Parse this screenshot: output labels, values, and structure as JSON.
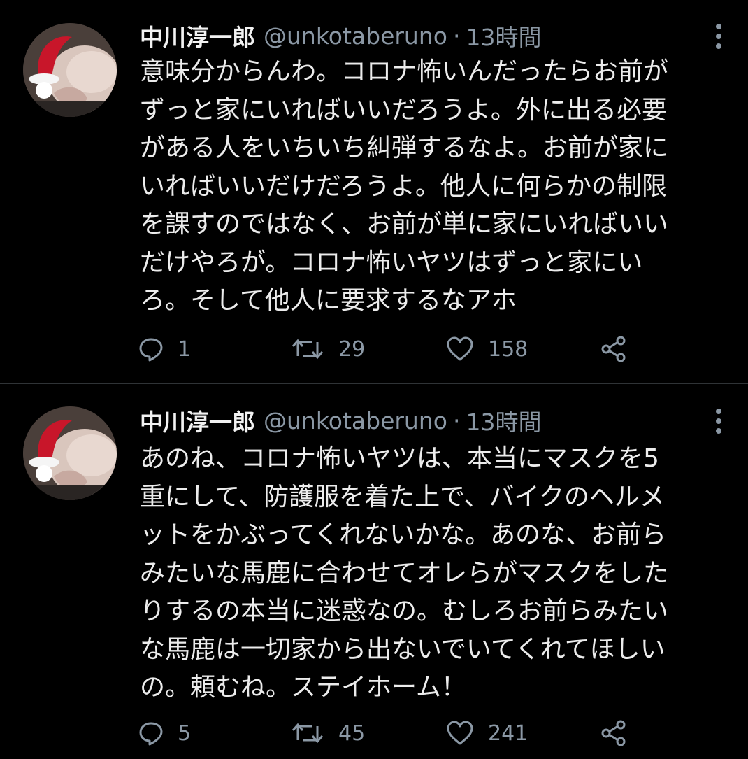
{
  "colors": {
    "background": "#000000",
    "text": "#e7e9ea",
    "secondary": "#8b98a5",
    "divider": "#2f3336"
  },
  "tweets": [
    {
      "name": "中川淳一郎",
      "handle": "@unkotaberuno",
      "separator": "·",
      "time": "13時間",
      "lines": [
        "意味分からんわ。コロナ怖いんだったらお前が",
        "ずっと家にいればいいだろうよ。外に出る必要",
        "がある人をいちいち糾弾するなよ。お前が家に",
        "いればいいだけだろうよ。他人に何らかの制限",
        "を課すのではなく、お前が単に家にいればいい",
        "だけやろが。コロナ怖いヤツはずっと家にい",
        "ろ。そして他人に要求するなアホ"
      ],
      "replies": "1",
      "retweets": "29",
      "likes": "158",
      "icons": {
        "avatar": "avatar-santa-hat",
        "more": "more-vertical-icon",
        "reply": "reply-icon",
        "retweet": "retweet-icon",
        "like": "heart-icon",
        "share": "share-icon"
      }
    },
    {
      "name": "中川淳一郎",
      "handle": "@unkotaberuno",
      "separator": "·",
      "time": "13時間",
      "lines": [
        "あのね、コロナ怖いヤツは、本当にマスクを5",
        "重にして、防護服を着た上で、バイクのヘルメ",
        "ットをかぶってくれないかな。あのな、お前ら",
        "みたいな馬鹿に合わせてオレらがマスクをした",
        "りするの本当に迷惑なの。むしろお前らみたい",
        "な馬鹿は一切家から出ないでいてくれてほしい",
        "の。頼むね。ステイホーム！"
      ],
      "replies": "5",
      "retweets": "45",
      "likes": "241",
      "icons": {
        "avatar": "avatar-santa-hat",
        "more": "more-vertical-icon",
        "reply": "reply-icon",
        "retweet": "retweet-icon",
        "like": "heart-icon",
        "share": "share-icon"
      }
    }
  ]
}
